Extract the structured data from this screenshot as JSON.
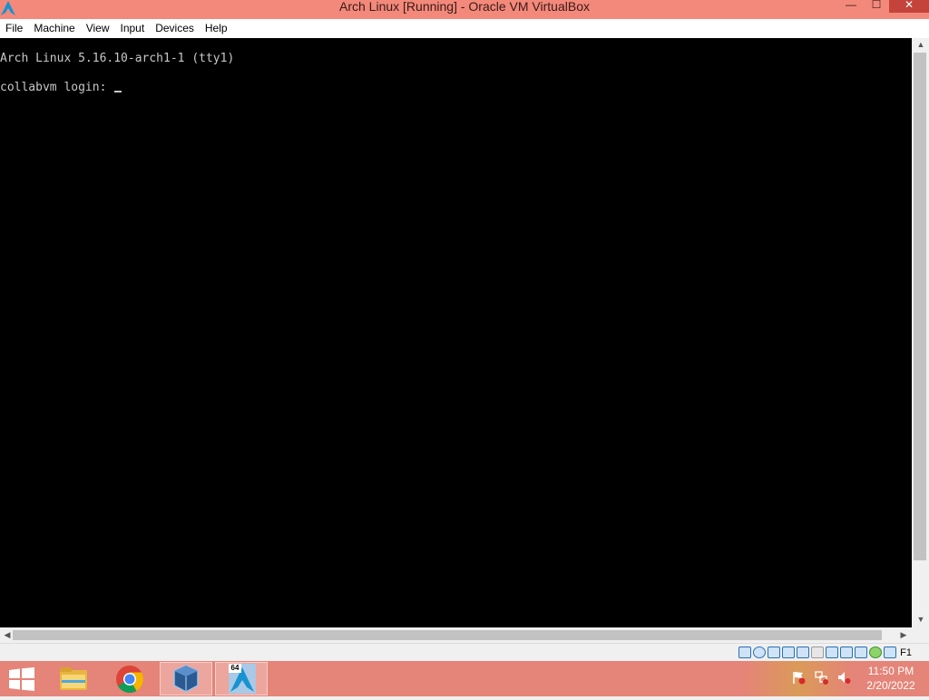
{
  "window": {
    "title": "Arch Linux [Running] - Oracle VM VirtualBox",
    "controls": {
      "minimize": "—",
      "maximize": "☐",
      "close": "✕"
    }
  },
  "menu": {
    "items": [
      "File",
      "Machine",
      "View",
      "Input",
      "Devices",
      "Help"
    ]
  },
  "console": {
    "line1": "Arch Linux 5.16.10-arch1-1 (tty1)",
    "line2": "collabvm login: "
  },
  "statusbar": {
    "icons": [
      "hard-disk-icon",
      "optical-drive-icon",
      "audio-icon",
      "network-icon",
      "usb-icon",
      "shared-folders-icon",
      "display-icon",
      "video-capture-icon",
      "virtualization-icon",
      "guest-additions-icon",
      "mouse-integration-icon"
    ],
    "host_key": "F1"
  },
  "taskbar": {
    "apps": [
      "file-explorer-icon",
      "chrome-icon",
      "virtualbox-icon",
      "arch-linux-vm-icon"
    ],
    "arch_badge": "64",
    "time": "11:50 PM",
    "date": "2/20/2022"
  },
  "colors": {
    "titlebar": "#f3897a",
    "taskbar": "#e58478",
    "console_bg": "#000000",
    "console_text": "#c8c8c8"
  }
}
